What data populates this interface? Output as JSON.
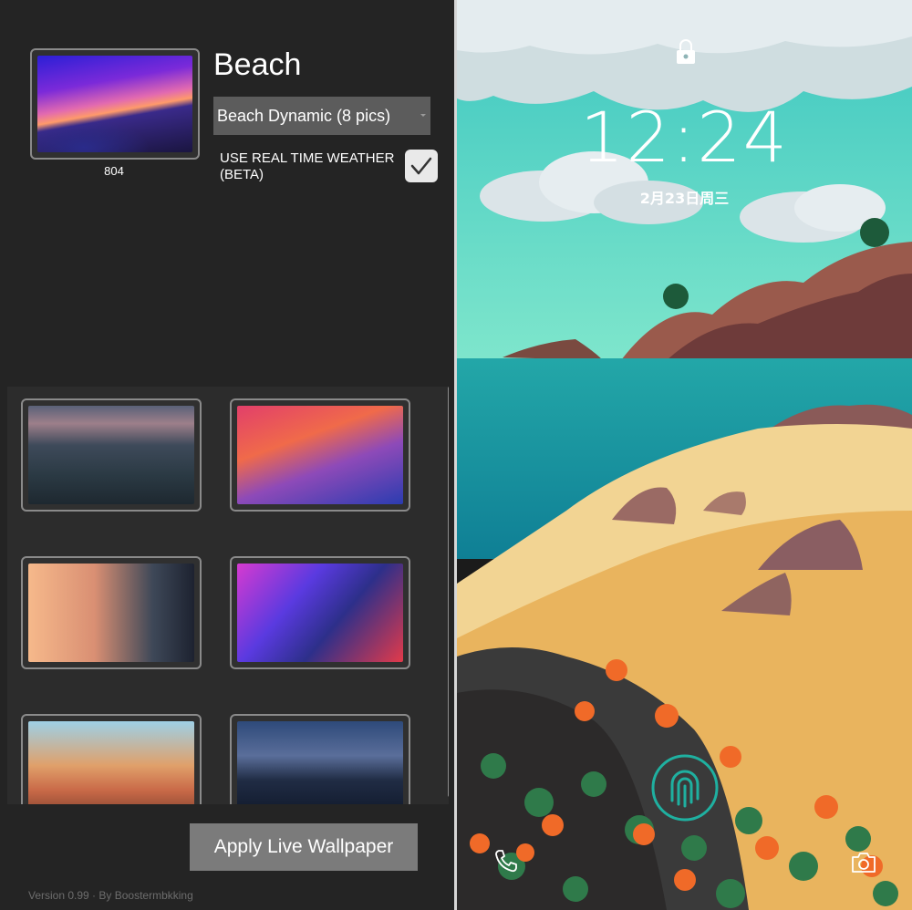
{
  "settings": {
    "current": {
      "title": "Beach",
      "id": "804",
      "set_option": "Beach Dynamic (8 pics)",
      "thumb_icon": "beach-sunset-thumbnail"
    },
    "weather": {
      "label": "USE REAL TIME WEATHER (BETA)",
      "checked": true
    },
    "wallpapers": [
      {
        "name": "island-dusk-thumbnail"
      },
      {
        "name": "big-sur-waves-thumbnail"
      },
      {
        "name": "desert-rock-day-night-thumbnail"
      },
      {
        "name": "neon-abstract-thumbnail"
      },
      {
        "name": "canyon-day-night-thumbnail"
      },
      {
        "name": "catalina-island-thumbnail"
      }
    ],
    "apply_label": "Apply Live Wallpaper",
    "version": "Version 0.99 · By Boostermbkking"
  },
  "lockscreen": {
    "time": "12:24",
    "date": "2月23日周三",
    "icons": [
      "lock-icon",
      "fingerprint-icon",
      "phone-icon",
      "camera-icon"
    ]
  },
  "colors": {
    "panel_bg": "#242424",
    "grid_bg": "#2c2c2c",
    "button_bg": "#7b7b7b",
    "sea": "#1f9aa0",
    "sand": "#f2c77a",
    "sky": "#6fdcc8"
  }
}
